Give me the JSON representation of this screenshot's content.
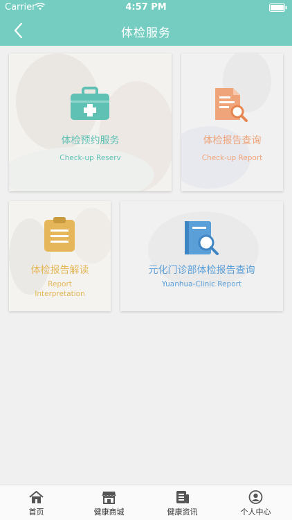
{
  "status_bar": {
    "carrier": "Carrier",
    "time": "4:57 PM"
  },
  "nav": {
    "title": "体检服务",
    "back_icon": "chevron-left-icon"
  },
  "colors": {
    "header": "#74cdc0",
    "teal": "#5fc1b4",
    "orange": "#f0a47a",
    "gold": "#e5b75a",
    "blue": "#5b9fd9"
  },
  "cards": [
    {
      "title_cn": "体检预约服务",
      "title_en": "Check-up Reserv",
      "icon": "medical-kit-icon"
    },
    {
      "title_cn": "体检报告查询",
      "title_en": "Check-up Report",
      "icon": "report-search-icon"
    },
    {
      "title_cn": "体检报告解读",
      "title_en_line1": "Report",
      "title_en_line2": "Interpretation",
      "icon": "clipboard-icon"
    },
    {
      "title_cn": "元化门诊部体检报告查询",
      "title_en": "Yuanhua-Clinic Report",
      "icon": "book-search-icon"
    }
  ],
  "tabs": [
    {
      "label": "首页",
      "icon": "home-icon"
    },
    {
      "label": "健康商城",
      "icon": "store-icon"
    },
    {
      "label": "健康资讯",
      "icon": "news-icon"
    },
    {
      "label": "个人中心",
      "icon": "user-icon"
    }
  ]
}
